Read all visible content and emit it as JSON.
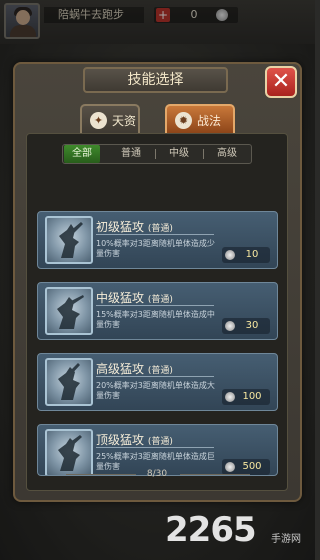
{
  "hud": {
    "player_name": "陪蜗牛去跑步",
    "coin_plus": "+",
    "coin_value": "0"
  },
  "dialog": {
    "title": "技能选择",
    "close_glyph": "✕",
    "tabs": [
      {
        "label": "天资",
        "icon": "talent-icon",
        "active": false
      },
      {
        "label": "战法",
        "icon": "tactic-icon",
        "active": true
      }
    ],
    "filters": [
      {
        "label": "全部",
        "active": true
      },
      {
        "label": "普通",
        "active": false
      },
      {
        "label": "中级",
        "active": false
      },
      {
        "label": "高级",
        "active": false
      }
    ],
    "skills": [
      {
        "name": "初级猛攻",
        "tier": "(普通)",
        "desc": "10%概率对3距离随机单体造成少量伤害",
        "cost": "10"
      },
      {
        "name": "中级猛攻",
        "tier": "(普通)",
        "desc": "15%概率对3距离随机单体造成中量伤害",
        "cost": "30"
      },
      {
        "name": "高级猛攻",
        "tier": "(普通)",
        "desc": "20%概率对3距离随机单体造成大量伤害",
        "cost": "100"
      },
      {
        "name": "顶级猛攻",
        "tier": "(普通)",
        "desc": "25%概率对3距离随机单体造成巨量伤害",
        "cost": "500"
      }
    ],
    "page_indicator": "8/30"
  },
  "watermark": {
    "brand": "2265",
    "site": "手游网"
  },
  "colors": {
    "accent_red": "#c9312a",
    "active_filter_green": "#3f8a2c",
    "active_tab_orange": "#c9793a",
    "card_blue": "#465e72"
  }
}
